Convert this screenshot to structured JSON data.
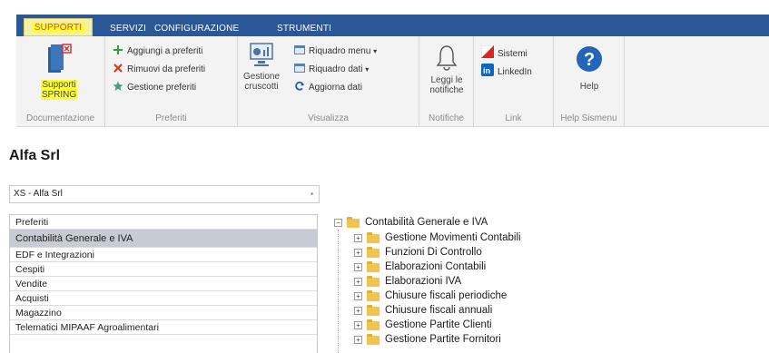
{
  "tabs": [
    {
      "label": "SUPPORTI",
      "active": true
    },
    {
      "label": "SERVIZI",
      "active": false
    },
    {
      "label": "CONFIGURAZIONE",
      "active": false
    },
    {
      "label": "STRUMENTI",
      "active": false
    }
  ],
  "ribbon": {
    "documentazione": {
      "group_label": "Documentazione",
      "supporti_spring_line1": "Supporti",
      "supporti_spring_line2": "SPRING"
    },
    "preferiti": {
      "group_label": "Preferiti",
      "aggiungi": "Aggiungi a preferiti",
      "rimuovi": "Rimuovi da preferiti",
      "gestione": "Gestione preferiti"
    },
    "visualizza": {
      "group_label": "Visualizza",
      "gestione_cruscotti_line1": "Gestione",
      "gestione_cruscotti_line2": "cruscotti",
      "riquadro_menu": "Riquadro menu",
      "riquadro_dati": "Riquadro dati",
      "aggiorna_dati": "Aggiorna dati"
    },
    "notifiche": {
      "group_label": "Notifiche",
      "leggi_line1": "Leggi le",
      "leggi_line2": "notifiche"
    },
    "link": {
      "group_label": "Link",
      "sistemi": "Sistemi",
      "linkedin": "LinkedIn"
    },
    "help_sismenu": {
      "group_label": "Help Sismenu",
      "help": "Help"
    }
  },
  "company_title": "Alfa Srl",
  "company_select": {
    "value": "XS - Alfa Srl"
  },
  "left_list": {
    "header": "Preferiti",
    "items": [
      {
        "label": "Contabilità Generale e IVA",
        "selected": true
      },
      {
        "label": "EDF e Integrazioni",
        "selected": false
      },
      {
        "label": "Cespiti",
        "selected": false
      },
      {
        "label": "Vendite",
        "selected": false
      },
      {
        "label": "Acquisti",
        "selected": false
      },
      {
        "label": "Magazzino",
        "selected": false
      },
      {
        "label": "Telematici MIPAAF Agroalimentari",
        "selected": false
      }
    ]
  },
  "tree": {
    "root": "Contabilità Generale e IVA",
    "children": [
      "Gestione Movimenti Contabili",
      "Funzioni Di Controllo",
      "Elaborazioni Contabili",
      "Elaborazioni IVA",
      "Chiusure fiscali periodiche",
      "Chiusure fiscali annuali",
      "Gestione Partite Clienti",
      "Gestione Partite Fornitori"
    ]
  },
  "colors": {
    "ribbon_tab_bar": "#2b5797",
    "ribbon_body": "#f3f3f3",
    "highlight": "#ffff33",
    "selected_row": "#c7cbd4",
    "folder": "#f1c350"
  }
}
